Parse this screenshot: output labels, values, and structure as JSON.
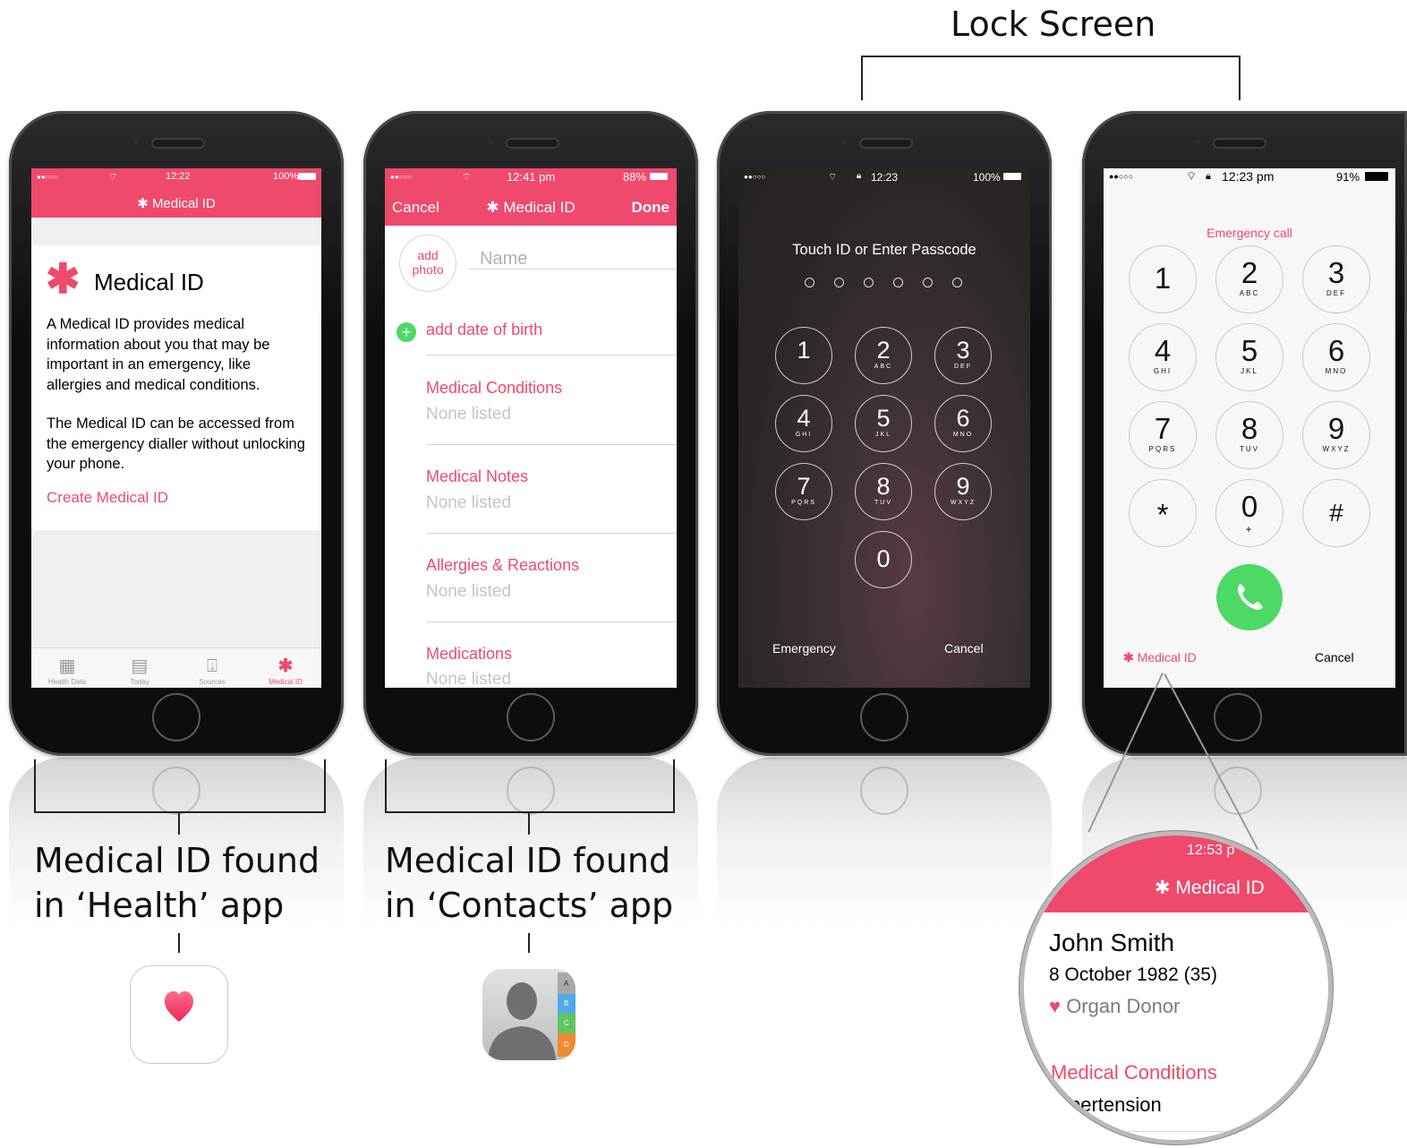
{
  "header": {
    "lock_screen_label": "Lock Screen"
  },
  "captions": {
    "health_line1": "Medical ID found",
    "health_line2": "in ‘Health’ app",
    "contacts_line1": "Medical ID found",
    "contacts_line2": "in ‘Contacts’ app"
  },
  "phone_health": {
    "status": {
      "signal": "●●○○○",
      "time": "12:22",
      "battery": "100%"
    },
    "nav_title": "✱ Medical ID",
    "heading": "Medical ID",
    "para1": "A Medical ID provides medical information about you that may be important in an emergency, like allergies and medical conditions.",
    "para2": "The Medical ID can be accessed from the emergency dialler without unlocking your phone.",
    "create_link": "Create Medical ID",
    "tabs": [
      {
        "label": "Health Data",
        "icon": "grid-icon"
      },
      {
        "label": "Today",
        "icon": "calendar-icon"
      },
      {
        "label": "Sources",
        "icon": "download-icon"
      },
      {
        "label": "Medical ID",
        "icon": "asterisk-icon"
      }
    ]
  },
  "phone_contacts": {
    "status": {
      "signal": "●●○○○",
      "time": "12:41 pm",
      "battery": "88%"
    },
    "cancel": "Cancel",
    "nav_title": "✱ Medical ID",
    "done": "Done",
    "add_photo": "add photo",
    "name_placeholder": "Name",
    "add_dob": "add date of birth",
    "sections": [
      {
        "label": "Medical Conditions",
        "value": "None listed"
      },
      {
        "label": "Medical Notes",
        "value": "None listed"
      },
      {
        "label": "Allergies & Reactions",
        "value": "None listed"
      },
      {
        "label": "Medications",
        "value": "None listed"
      }
    ]
  },
  "phone_lock": {
    "status": {
      "signal": "●●○○○",
      "time": "12:23",
      "battery": "100%"
    },
    "prompt": "Touch ID or Enter Passcode",
    "keys": [
      {
        "n": "1",
        "l": ""
      },
      {
        "n": "2",
        "l": "ABC"
      },
      {
        "n": "3",
        "l": "DEF"
      },
      {
        "n": "4",
        "l": "GHI"
      },
      {
        "n": "5",
        "l": "JKL"
      },
      {
        "n": "6",
        "l": "MNO"
      },
      {
        "n": "7",
        "l": "PQRS"
      },
      {
        "n": "8",
        "l": "TUV"
      },
      {
        "n": "9",
        "l": "WXYZ"
      },
      {
        "n": "0",
        "l": ""
      }
    ],
    "emergency": "Emergency",
    "cancel": "Cancel"
  },
  "phone_emergency": {
    "status": {
      "signal": "●●○○○",
      "time": "12:23 pm",
      "battery": "91%"
    },
    "title": "Emergency call",
    "keys": [
      {
        "n": "1",
        "l": ""
      },
      {
        "n": "2",
        "l": "ABC"
      },
      {
        "n": "3",
        "l": "DEF"
      },
      {
        "n": "4",
        "l": "GHI"
      },
      {
        "n": "5",
        "l": "JKL"
      },
      {
        "n": "6",
        "l": "MNO"
      },
      {
        "n": "7",
        "l": "PQRS"
      },
      {
        "n": "8",
        "l": "TUV"
      },
      {
        "n": "9",
        "l": "WXYZ"
      },
      {
        "n": "*",
        "l": ""
      },
      {
        "n": "0",
        "l": "+"
      },
      {
        "n": "#",
        "l": ""
      }
    ],
    "medical_id_link": "Medical ID",
    "cancel": "Cancel"
  },
  "magnifier": {
    "time": "12:53 p",
    "nav_title": "✱ Medical ID",
    "name": "John Smith",
    "dob": "8 October 1982 (35)",
    "donor": "Organ Donor",
    "conditions_label": "Medical Conditions",
    "conditions_value": "ypertension"
  },
  "colors": {
    "accent": "#ef4a6b",
    "call_green": "#4cd964"
  }
}
